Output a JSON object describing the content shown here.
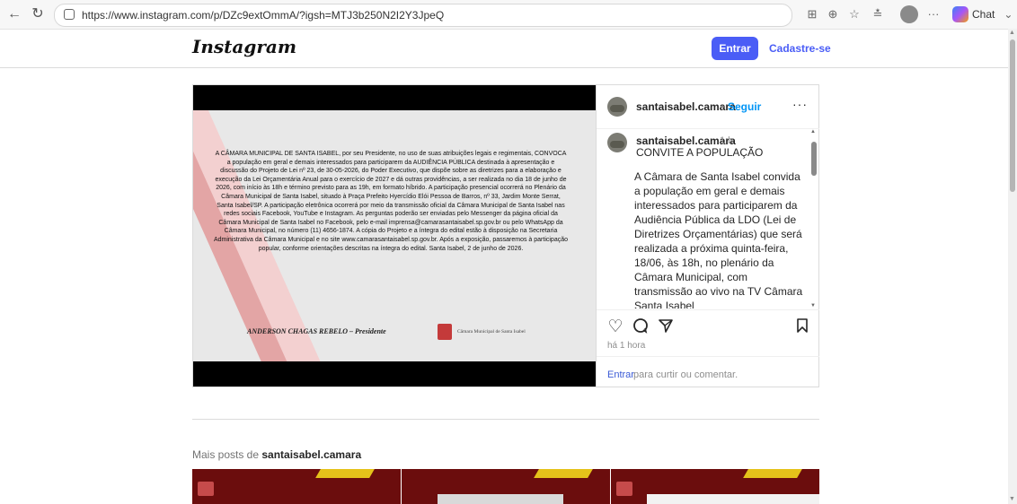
{
  "browser": {
    "url": "https://www.instagram.com/p/DZc9extOmmA/?igsh=MTJ3b250N2I2Y3JpeQ",
    "chat_label": "Chat",
    "icons": [
      "back-icon",
      "refresh-icon",
      "lock-icon",
      "apps-icon",
      "zoom-icon",
      "favorite-icon",
      "collections-icon",
      "profile-icon",
      "more-icon",
      "copilot-icon",
      "chevron-down-icon"
    ]
  },
  "header": {
    "logo": "Instagram",
    "login_label": "Entrar",
    "signup_label": "Cadastre-se"
  },
  "post": {
    "username": "santaisabel.camara",
    "separator": "•",
    "follow_label": "Seguir",
    "more_label": "···",
    "time_ago": "1 h",
    "caption_title": "CONVITE A POPULAÇÃO",
    "caption_body": "A Câmara de Santa Isabel convida a população em geral e demais interessados para participarem da Audiência Pública da LDO (Lei de Diretrizes Orçamentárias) que será realizada a próxima quinta-feira, 18/06, às 18h, no plenário da Câmara Municipal, com transmissão ao vivo na TV Câmara Santa Isabel (https://www.youtube.com/@tvcamaracmsi), Facebook da Câmara Municipal de Santa Isabel",
    "posted": "há 1 hora",
    "login_link": "Entrar",
    "login_suffix": " para curtir ou comentar.",
    "media": {
      "announcement": "A CÂMARA MUNICIPAL DE SANTA ISABEL, por seu Presidente, no uso de suas atribuições legais e regimentais, CONVOCA a população em geral e demais interessados para participarem da AUDIÊNCIA PÚBLICA destinada à apresentação e discussão do Projeto de Lei nº 23, de 30-05-2026, do Poder Executivo, que dispõe sobre as diretrizes para a elaboração e execução da Lei Orçamentária Anual para o exercício de 2027 e dá outras providências, a ser realizada no dia 18 de junho de 2026, com início às 18h e término previsto para as 19h, em formato híbrido. A participação presencial ocorrerá no Plenário da Câmara Municipal de Santa Isabel, situado à Praça Prefeito Hyercídio Elói Pessoa de Barros, nº 33, Jardim Monte Serrat, Santa Isabel/SP. A participação eletrônica ocorrerá por meio da transmissão oficial da Câmara Municipal de Santa Isabel nas redes sociais Facebook, YouTube e Instagram. As perguntas poderão ser enviadas pelo Messenger da página oficial da Câmara Municipal de Santa Isabel no Facebook, pelo e-mail imprensa@camarasantaisabel.sp.gov.br ou pelo WhatsApp da Câmara Municipal, no número (11) 4656-1874. A cópia do Projeto e a íntegra do edital estão à disposição na Secretaria Administrativa da Câmara Municipal e no site www.camarasantaisabel.sp.gov.br. Após a exposição, passaremos à participação popular, conforme orientações descritas na íntegra do edital. Santa Isabel, 2 de junho de 2026.",
      "signer": "ANDERSON CHAGAS REBELO – Presidente",
      "institution": "Câmara Municipal de Santa Isabel"
    }
  },
  "more_posts": {
    "prefix": "Mais posts de ",
    "username": "santaisabel.camara"
  },
  "colors": {
    "accent": "#4a5df6",
    "link": "#0095f6",
    "brand_red": "#6b0d0d"
  }
}
